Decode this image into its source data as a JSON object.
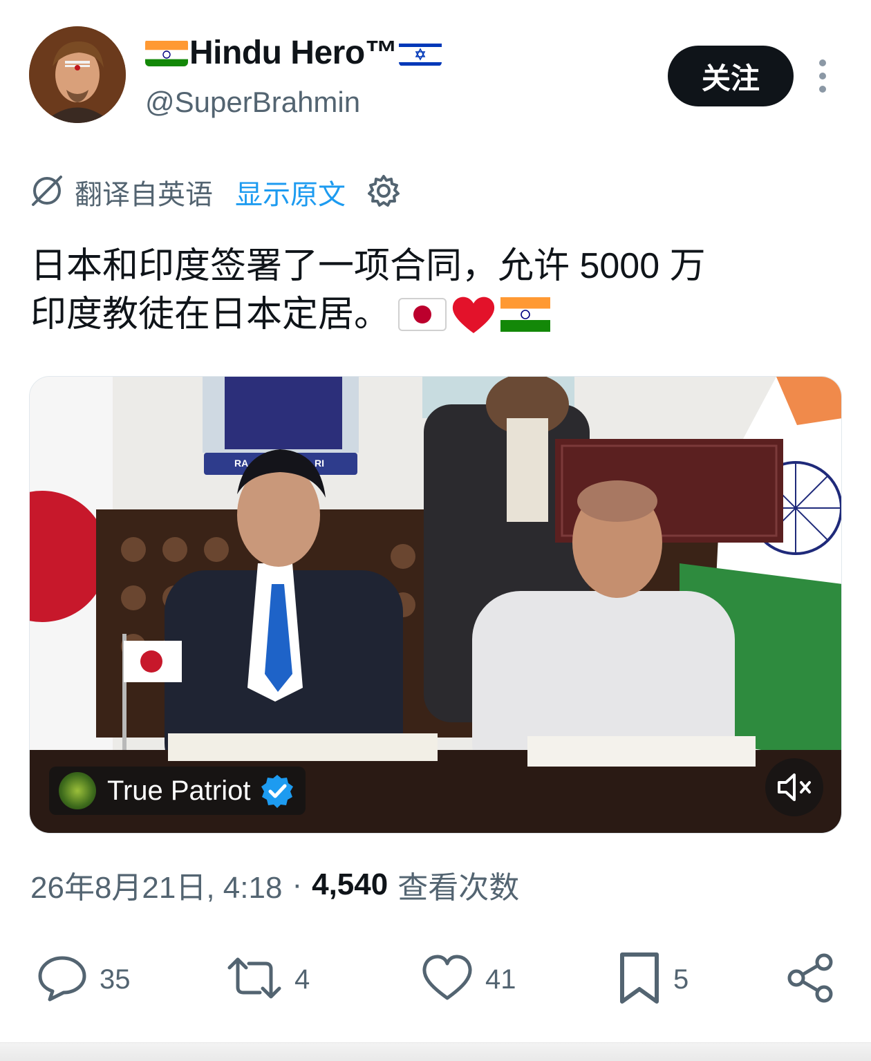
{
  "author": {
    "name_text": "Hindu Hero™",
    "handle": "@SuperBrahmin",
    "follow_label": "关注"
  },
  "translation": {
    "label": "翻译自英语",
    "show_original": "显示原文"
  },
  "tweet": {
    "text_line1": "日本和印度签署了一项合同，允许 5000 万",
    "text_line2": "印度教徒在日本定居。"
  },
  "media": {
    "source_name": "True Patriot",
    "nameplate_text": "RA",
    "nameplate_text_2": "RI"
  },
  "meta": {
    "date": "26年8月21日, 4:18",
    "separator": "·",
    "views_count": "4,540",
    "views_label": "查看次数"
  },
  "actions": {
    "replies": "35",
    "reposts": "4",
    "likes": "41",
    "bookmarks": "5"
  },
  "colors": {
    "text": "#0f1419",
    "secondary": "#536471",
    "link": "#1d9bf0",
    "follow_bg": "#0f1419",
    "verified": "#1d9bf0"
  }
}
